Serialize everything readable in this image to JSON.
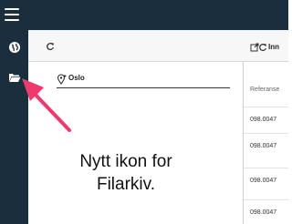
{
  "topbar": {
    "menu_icon": "hamburger-menu-icon"
  },
  "sidebar": {
    "items": [
      {
        "icon": "globe-icon"
      },
      {
        "icon": "folder-open-icon"
      }
    ]
  },
  "main": {
    "toolbar": {
      "refresh_icon": "refresh-icon"
    },
    "tree": {
      "icon": "map-pin-icon",
      "label": "Oslo"
    }
  },
  "right_panel": {
    "header_icons": [
      "external-link-icon",
      "refresh-icon"
    ],
    "header_label": "Inn",
    "column_header": "Referanse",
    "rows": [
      "098.0047",
      "098.0047",
      "098.0047",
      "098.0047"
    ]
  },
  "annotation": {
    "line1": "Nytt ikon for",
    "line2": "Filarkiv.",
    "color": "#f0386b"
  },
  "colors": {
    "nav_bg": "#1a2e3e",
    "accent": "#f0386b"
  }
}
